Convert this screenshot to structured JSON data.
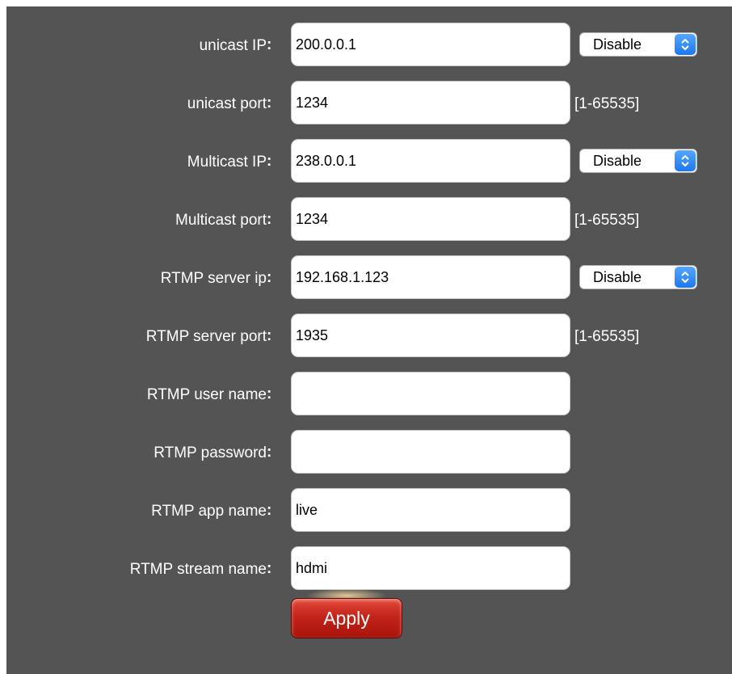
{
  "colors": {
    "panel_bg": "#545454",
    "apply_button": "#c3241a",
    "select_arrow": "#1f77f0"
  },
  "form": {
    "colon": ":",
    "rows": [
      {
        "label": "unicast IP",
        "value": "200.0.0.1",
        "select": "Disable"
      },
      {
        "label": "unicast port",
        "value": "1234",
        "range": "[1-65535]"
      },
      {
        "label": "Multicast IP",
        "value": "238.0.0.1",
        "select": "Disable"
      },
      {
        "label": "Multicast port",
        "value": "1234",
        "range": "[1-65535]"
      },
      {
        "label": "RTMP server ip",
        "value": "192.168.1.123",
        "select": "Disable"
      },
      {
        "label": "RTMP server port",
        "value": "1935",
        "range": "[1-65535]"
      },
      {
        "label": "RTMP user name",
        "value": ""
      },
      {
        "label": "RTMP password",
        "value": ""
      },
      {
        "label": "RTMP app name",
        "value": "live"
      },
      {
        "label": "RTMP stream name",
        "value": "hdmi"
      }
    ],
    "select_icon": "updown-chevron-icon",
    "apply_label": "Apply"
  }
}
